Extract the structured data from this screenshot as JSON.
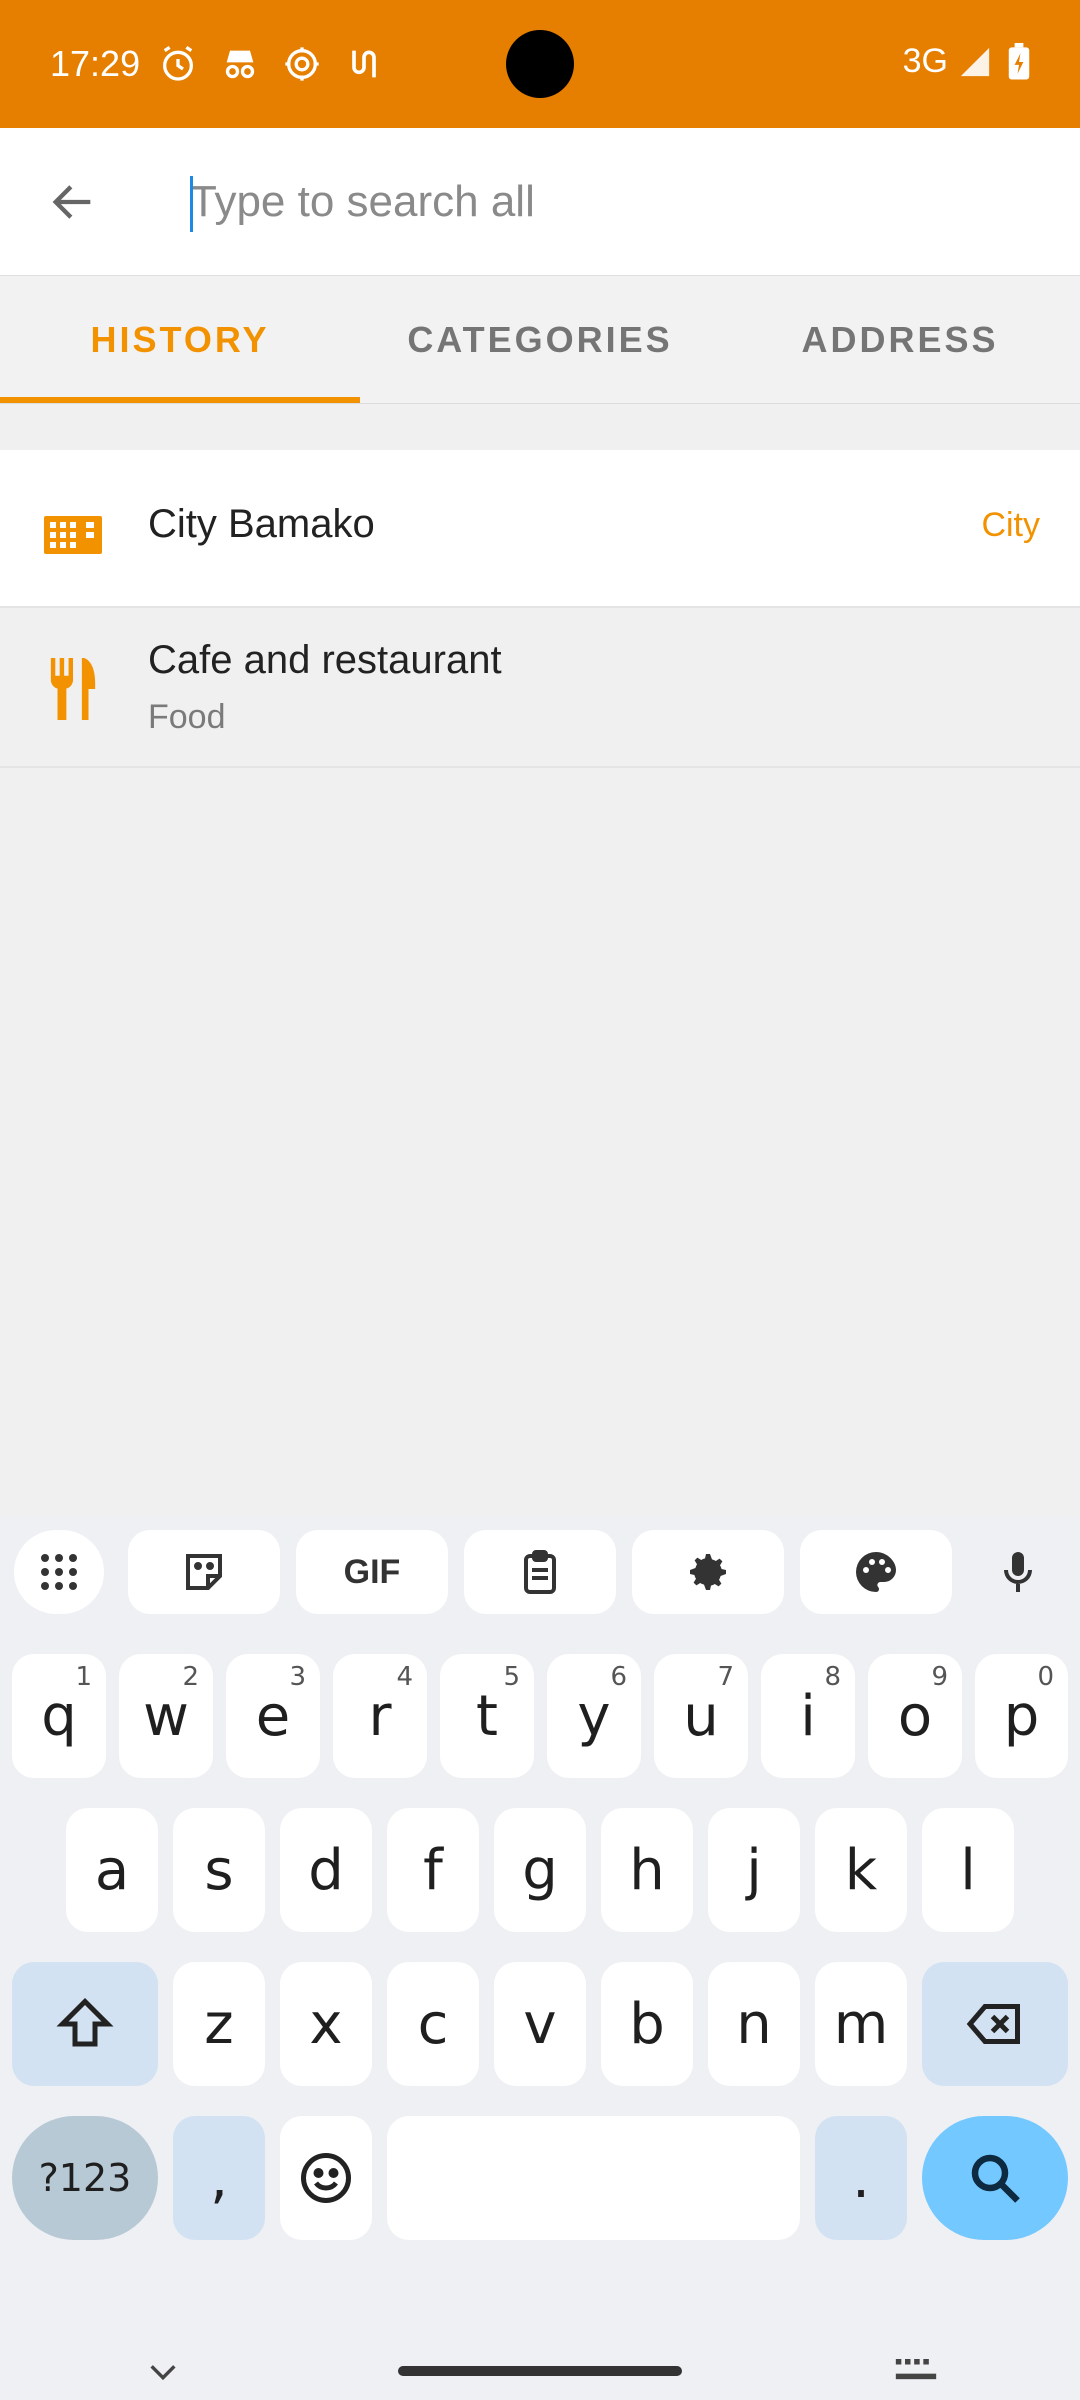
{
  "status_bar": {
    "time": "17:29",
    "network": "3G",
    "icons": [
      "alarm-icon",
      "incognito-icon",
      "settings-icon",
      "accessibility-icon"
    ]
  },
  "search": {
    "placeholder": "Type to search all",
    "value": ""
  },
  "tabs": [
    {
      "label": "HISTORY",
      "active": true
    },
    {
      "label": "CATEGORIES",
      "active": false
    },
    {
      "label": "ADDRESS",
      "active": false
    }
  ],
  "results": [
    {
      "title": "City Bamako",
      "type": "City",
      "icon": "city-icon"
    },
    {
      "title": "Cafe and restaurant",
      "subtitle": "Food",
      "icon": "restaurant-icon"
    }
  ],
  "keyboard": {
    "toolbar": [
      "apps-icon",
      "sticker-icon",
      "GIF",
      "clipboard-icon",
      "settings-icon",
      "palette-icon",
      "mic-icon"
    ],
    "row1": [
      {
        "key": "q",
        "hint": "1"
      },
      {
        "key": "w",
        "hint": "2"
      },
      {
        "key": "e",
        "hint": "3"
      },
      {
        "key": "r",
        "hint": "4"
      },
      {
        "key": "t",
        "hint": "5"
      },
      {
        "key": "y",
        "hint": "6"
      },
      {
        "key": "u",
        "hint": "7"
      },
      {
        "key": "i",
        "hint": "8"
      },
      {
        "key": "o",
        "hint": "9"
      },
      {
        "key": "p",
        "hint": "0"
      }
    ],
    "row2": [
      "a",
      "s",
      "d",
      "f",
      "g",
      "h",
      "j",
      "k",
      "l"
    ],
    "row3": [
      "z",
      "x",
      "c",
      "v",
      "b",
      "n",
      "m"
    ],
    "symbols_label": "?123",
    "comma": ",",
    "period": "."
  },
  "colors": {
    "accent": "#f29200",
    "status_bar": "#e67e00",
    "keyboard_action": "#73c8ff"
  }
}
